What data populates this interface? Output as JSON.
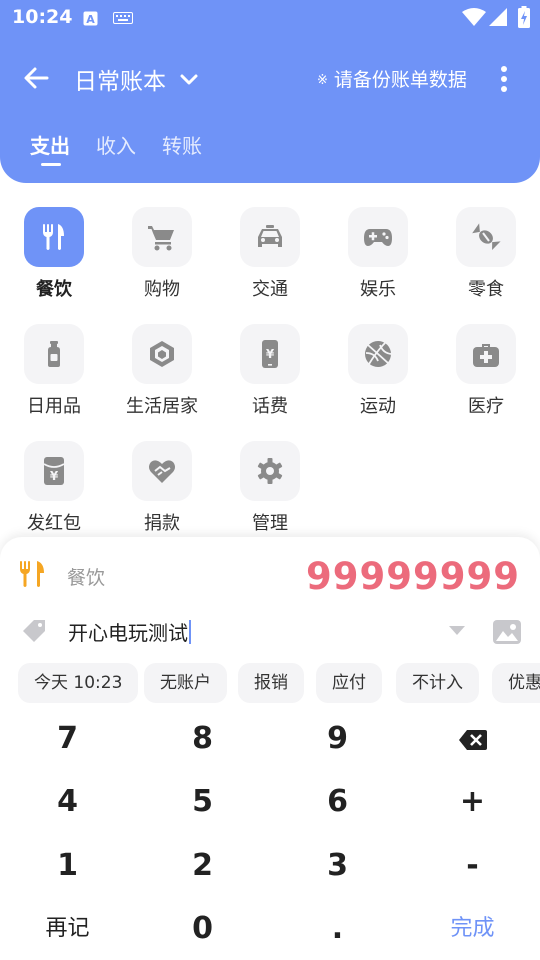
{
  "status_bar": {
    "time": "10:24"
  },
  "toolbar": {
    "book_title": "日常账本",
    "backup_prefix": "※",
    "backup_text": "请备份账单数据",
    "back_icon": "arrow-left-icon",
    "more_icon": "more-vert-icon"
  },
  "tabs": [
    {
      "label": "支出",
      "active": true
    },
    {
      "label": "收入",
      "active": false
    },
    {
      "label": "转账",
      "active": false
    }
  ],
  "categories": [
    {
      "label": "餐饮",
      "icon": "fork-knife-icon",
      "selected": true
    },
    {
      "label": "购物",
      "icon": "cart-icon",
      "selected": false
    },
    {
      "label": "交通",
      "icon": "taxi-icon",
      "selected": false
    },
    {
      "label": "娱乐",
      "icon": "gamepad-icon",
      "selected": false
    },
    {
      "label": "零食",
      "icon": "candy-icon",
      "selected": false
    },
    {
      "label": "日用品",
      "icon": "bottle-icon",
      "selected": false
    },
    {
      "label": "生活居家",
      "icon": "home-hexagon-icon",
      "selected": false
    },
    {
      "label": "话费",
      "icon": "phone-bill-icon",
      "selected": false
    },
    {
      "label": "运动",
      "icon": "basketball-icon",
      "selected": false
    },
    {
      "label": "医疗",
      "icon": "medical-kit-icon",
      "selected": false
    },
    {
      "label": "发红包",
      "icon": "red-envelope-icon",
      "selected": false
    },
    {
      "label": "捐款",
      "icon": "heart-hand-icon",
      "selected": false
    },
    {
      "label": "管理",
      "icon": "gear-icon",
      "selected": false
    }
  ],
  "entry": {
    "category": "餐饮",
    "amount": "99999999",
    "note": "开心电玩测试"
  },
  "chips": [
    "今天 10:23",
    "无账户",
    "报销",
    "应付",
    "不计入",
    "优惠"
  ],
  "keypad": {
    "rows": [
      [
        "7",
        "8",
        "9",
        "backspace"
      ],
      [
        "4",
        "5",
        "6",
        "+"
      ],
      [
        "1",
        "2",
        "3",
        "-"
      ],
      [
        "再记",
        "0",
        ".",
        "完成"
      ]
    ]
  },
  "colors": {
    "accent": "#6f93f7",
    "amount": "#ec6b7c",
    "chip_bg": "#f4f4f6",
    "category_icon": "#8a8a8a",
    "selected_icon_food": "#f5a623"
  }
}
